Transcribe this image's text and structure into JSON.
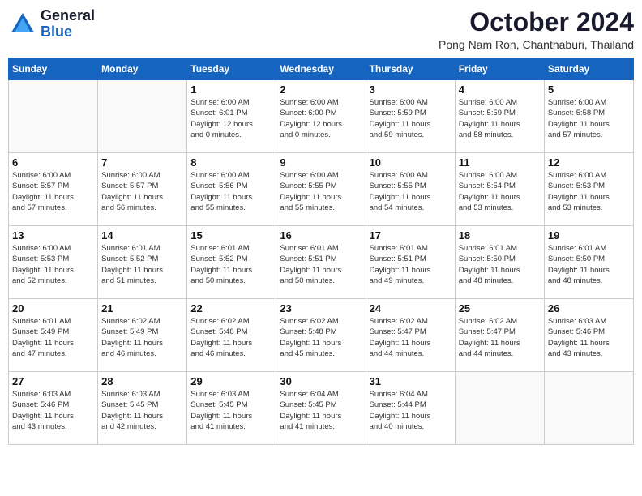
{
  "header": {
    "logo_line1": "General",
    "logo_line2": "Blue",
    "month": "October 2024",
    "location": "Pong Nam Ron, Chanthaburi, Thailand"
  },
  "weekdays": [
    "Sunday",
    "Monday",
    "Tuesday",
    "Wednesday",
    "Thursday",
    "Friday",
    "Saturday"
  ],
  "weeks": [
    [
      {
        "day": "",
        "detail": ""
      },
      {
        "day": "",
        "detail": ""
      },
      {
        "day": "1",
        "detail": "Sunrise: 6:00 AM\nSunset: 6:01 PM\nDaylight: 12 hours\nand 0 minutes."
      },
      {
        "day": "2",
        "detail": "Sunrise: 6:00 AM\nSunset: 6:00 PM\nDaylight: 12 hours\nand 0 minutes."
      },
      {
        "day": "3",
        "detail": "Sunrise: 6:00 AM\nSunset: 5:59 PM\nDaylight: 11 hours\nand 59 minutes."
      },
      {
        "day": "4",
        "detail": "Sunrise: 6:00 AM\nSunset: 5:59 PM\nDaylight: 11 hours\nand 58 minutes."
      },
      {
        "day": "5",
        "detail": "Sunrise: 6:00 AM\nSunset: 5:58 PM\nDaylight: 11 hours\nand 57 minutes."
      }
    ],
    [
      {
        "day": "6",
        "detail": "Sunrise: 6:00 AM\nSunset: 5:57 PM\nDaylight: 11 hours\nand 57 minutes."
      },
      {
        "day": "7",
        "detail": "Sunrise: 6:00 AM\nSunset: 5:57 PM\nDaylight: 11 hours\nand 56 minutes."
      },
      {
        "day": "8",
        "detail": "Sunrise: 6:00 AM\nSunset: 5:56 PM\nDaylight: 11 hours\nand 55 minutes."
      },
      {
        "day": "9",
        "detail": "Sunrise: 6:00 AM\nSunset: 5:55 PM\nDaylight: 11 hours\nand 55 minutes."
      },
      {
        "day": "10",
        "detail": "Sunrise: 6:00 AM\nSunset: 5:55 PM\nDaylight: 11 hours\nand 54 minutes."
      },
      {
        "day": "11",
        "detail": "Sunrise: 6:00 AM\nSunset: 5:54 PM\nDaylight: 11 hours\nand 53 minutes."
      },
      {
        "day": "12",
        "detail": "Sunrise: 6:00 AM\nSunset: 5:53 PM\nDaylight: 11 hours\nand 53 minutes."
      }
    ],
    [
      {
        "day": "13",
        "detail": "Sunrise: 6:00 AM\nSunset: 5:53 PM\nDaylight: 11 hours\nand 52 minutes."
      },
      {
        "day": "14",
        "detail": "Sunrise: 6:01 AM\nSunset: 5:52 PM\nDaylight: 11 hours\nand 51 minutes."
      },
      {
        "day": "15",
        "detail": "Sunrise: 6:01 AM\nSunset: 5:52 PM\nDaylight: 11 hours\nand 50 minutes."
      },
      {
        "day": "16",
        "detail": "Sunrise: 6:01 AM\nSunset: 5:51 PM\nDaylight: 11 hours\nand 50 minutes."
      },
      {
        "day": "17",
        "detail": "Sunrise: 6:01 AM\nSunset: 5:51 PM\nDaylight: 11 hours\nand 49 minutes."
      },
      {
        "day": "18",
        "detail": "Sunrise: 6:01 AM\nSunset: 5:50 PM\nDaylight: 11 hours\nand 48 minutes."
      },
      {
        "day": "19",
        "detail": "Sunrise: 6:01 AM\nSunset: 5:50 PM\nDaylight: 11 hours\nand 48 minutes."
      }
    ],
    [
      {
        "day": "20",
        "detail": "Sunrise: 6:01 AM\nSunset: 5:49 PM\nDaylight: 11 hours\nand 47 minutes."
      },
      {
        "day": "21",
        "detail": "Sunrise: 6:02 AM\nSunset: 5:49 PM\nDaylight: 11 hours\nand 46 minutes."
      },
      {
        "day": "22",
        "detail": "Sunrise: 6:02 AM\nSunset: 5:48 PM\nDaylight: 11 hours\nand 46 minutes."
      },
      {
        "day": "23",
        "detail": "Sunrise: 6:02 AM\nSunset: 5:48 PM\nDaylight: 11 hours\nand 45 minutes."
      },
      {
        "day": "24",
        "detail": "Sunrise: 6:02 AM\nSunset: 5:47 PM\nDaylight: 11 hours\nand 44 minutes."
      },
      {
        "day": "25",
        "detail": "Sunrise: 6:02 AM\nSunset: 5:47 PM\nDaylight: 11 hours\nand 44 minutes."
      },
      {
        "day": "26",
        "detail": "Sunrise: 6:03 AM\nSunset: 5:46 PM\nDaylight: 11 hours\nand 43 minutes."
      }
    ],
    [
      {
        "day": "27",
        "detail": "Sunrise: 6:03 AM\nSunset: 5:46 PM\nDaylight: 11 hours\nand 43 minutes."
      },
      {
        "day": "28",
        "detail": "Sunrise: 6:03 AM\nSunset: 5:45 PM\nDaylight: 11 hours\nand 42 minutes."
      },
      {
        "day": "29",
        "detail": "Sunrise: 6:03 AM\nSunset: 5:45 PM\nDaylight: 11 hours\nand 41 minutes."
      },
      {
        "day": "30",
        "detail": "Sunrise: 6:04 AM\nSunset: 5:45 PM\nDaylight: 11 hours\nand 41 minutes."
      },
      {
        "day": "31",
        "detail": "Sunrise: 6:04 AM\nSunset: 5:44 PM\nDaylight: 11 hours\nand 40 minutes."
      },
      {
        "day": "",
        "detail": ""
      },
      {
        "day": "",
        "detail": ""
      }
    ]
  ]
}
